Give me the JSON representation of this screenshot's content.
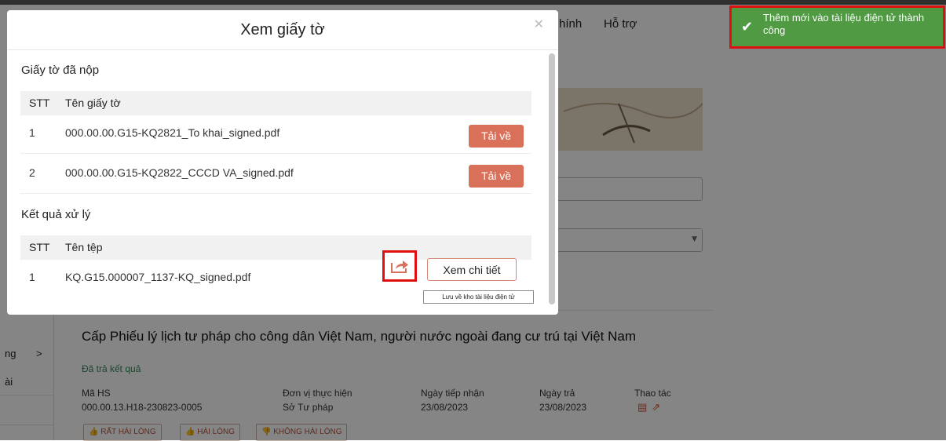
{
  "background": {
    "nav": [
      "hính",
      "Hỗ trợ"
    ],
    "left_menu": [
      "ng",
      ">",
      "ài"
    ],
    "procedure": {
      "title": "Cấp Phiếu lý lịch tư pháp cho công dân Việt Nam, người nước ngoài đang cư trú tại Việt Nam",
      "status": "Đã trả kết quả",
      "columns": [
        {
          "header": "Mã HS",
          "value": "000.00.13.H18-230823-0005"
        },
        {
          "header": "Đơn vị thực hiện",
          "value": "Sở Tư pháp"
        },
        {
          "header": "Ngày tiếp nhận",
          "value": "23/08/2023"
        },
        {
          "header": "Ngày trả",
          "value": "23/08/2023"
        },
        {
          "header": "Thao tác",
          "value": ""
        }
      ],
      "action_icons": [
        "document-search-icon",
        "share-icon"
      ],
      "ratings": [
        "RẤT HÀI LÒNG",
        "HÀI LÒNG",
        "KHÔNG HÀI LÒNG"
      ]
    }
  },
  "modal": {
    "title": "Xem giấy tờ",
    "close_icon": "close-icon",
    "submitted": {
      "title": "Giấy tờ đã nộp",
      "headers": [
        "STT",
        "Tên giấy tờ"
      ],
      "rows": [
        {
          "stt": "1",
          "name": "000.00.00.G15-KQ2821_To khai_signed.pdf",
          "action": "Tải về"
        },
        {
          "stt": "2",
          "name": "000.00.00.G15-KQ2822_CCCD VA_signed.pdf",
          "action": "Tải về"
        }
      ]
    },
    "results": {
      "title": "Kết quả xử lý",
      "headers": [
        "STT",
        "Tên tệp"
      ],
      "rows": [
        {
          "stt": "1",
          "name": "KQ.G15.000007_1137-KQ_signed.pdf",
          "view": "Xem chi tiết"
        }
      ],
      "save_icon": "share-arrow-icon",
      "tooltip": "Lưu về kho tài liệu điện tử"
    }
  },
  "toast": {
    "icon": "check-icon",
    "message": "Thêm mới vào tài liệu điện tử thành công",
    "color": "#4f9a42",
    "highlight": "#e01010"
  }
}
